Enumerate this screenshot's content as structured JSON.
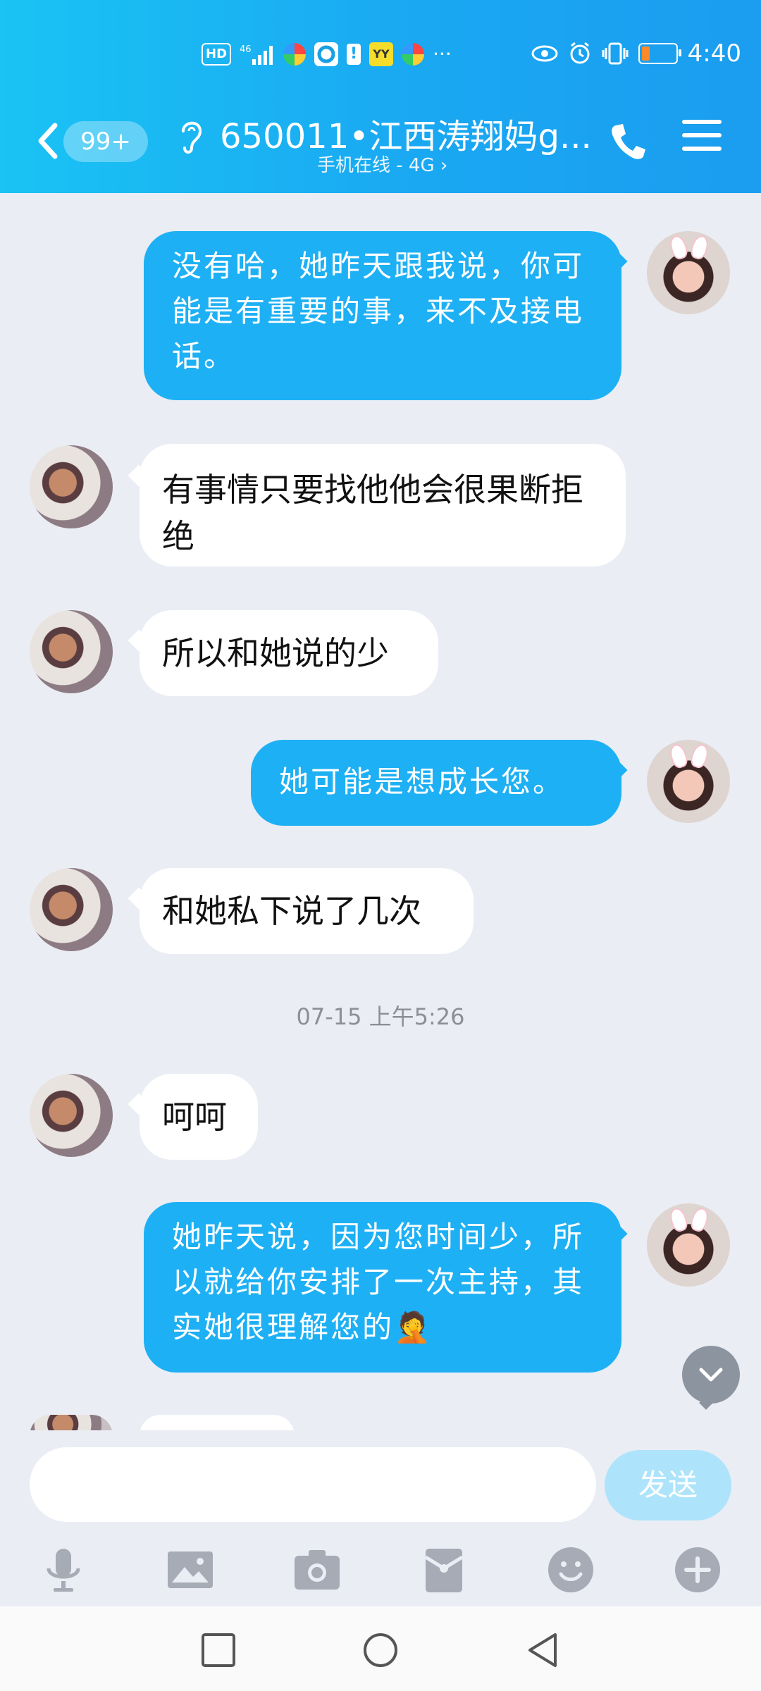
{
  "status_bar": {
    "icons": [
      "hd-icon",
      "4g-signal-icon",
      "app-icon-1",
      "app-icon-2",
      "alert-icon",
      "yy-app-icon",
      "app-icon-3",
      "more-icon"
    ],
    "hd": "HD",
    "network": "46",
    "yy": "YY",
    "more": "···",
    "time": "4:40",
    "battery_level": 0.25
  },
  "header": {
    "unread_badge": "99+",
    "title": "650011•江西涛翔妈g...",
    "subtitle": "手机在线 - 4G ›"
  },
  "messages": [
    {
      "side": "out",
      "text": "没有哈，她昨天跟我说，你可能是有重要的事，来不及接电话。"
    },
    {
      "side": "in",
      "text": "有事情只要找他他会很果断拒绝"
    },
    {
      "side": "in",
      "text": "所以和她说的少"
    },
    {
      "side": "out",
      "text": "她可能是想成长您。"
    },
    {
      "side": "in",
      "text": "和她私下说了几次"
    },
    {
      "side": "in",
      "text": "呵呵"
    },
    {
      "side": "out",
      "text": "她昨天说，因为您时间少，所以就给你安排了一次主持，其实她很理解您的🤦"
    }
  ],
  "timestamp": "07-15 上午5:26",
  "composer": {
    "placeholder": "",
    "send_label": "发送"
  },
  "toolbar": [
    "mic-icon",
    "image-icon",
    "camera-icon",
    "red-packet-icon",
    "emoji-icon",
    "plus-icon"
  ],
  "colors": {
    "header_start": "#1ac3f4",
    "header_end": "#1b9df0",
    "out_bubble": "#1eb0f4",
    "in_bubble": "#ffffff",
    "background": "#eaedf4",
    "send_button": "#aee4fb"
  }
}
